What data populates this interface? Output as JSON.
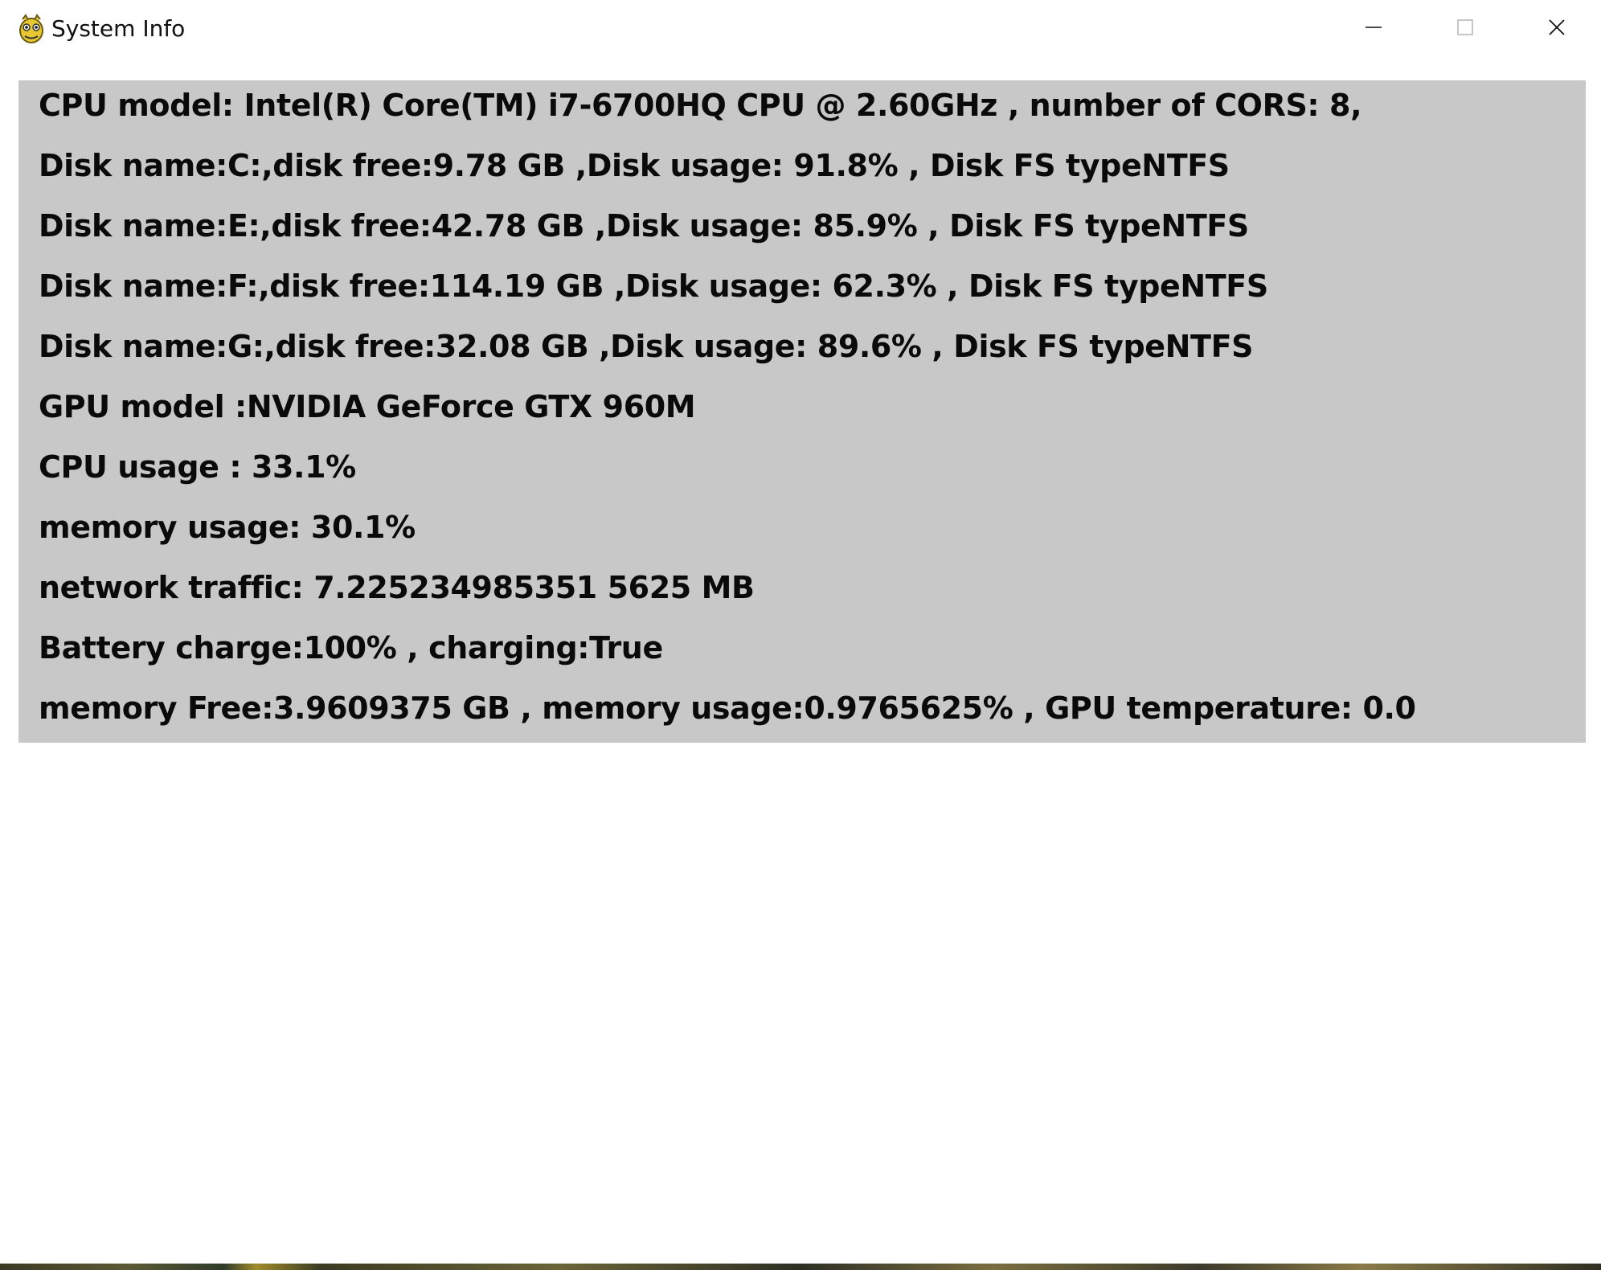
{
  "window": {
    "title": "System Info",
    "app_icon": "pygame-snake-icon",
    "controls": {
      "minimize_icon": "minimize-icon",
      "maximize_icon": "maximize-icon",
      "close_icon": "close-icon"
    }
  },
  "info": {
    "lines": [
      "CPU model: Intel(R) Core(TM) i7-6700HQ CPU @ 2.60GHz , number of CORS: 8,",
      "Disk name:C:,disk free:9.78  GB ,Disk usage: 91.8% , Disk FS typeNTFS",
      "Disk name:E:,disk free:42.78  GB ,Disk usage: 85.9% , Disk FS typeNTFS",
      "Disk name:F:,disk free:114.19  GB ,Disk usage: 62.3% , Disk FS typeNTFS",
      "Disk name:G:,disk free:32.08  GB ,Disk usage: 89.6% , Disk FS typeNTFS",
      "GPU model :NVIDIA GeForce GTX 960M",
      "CPU usage : 33.1%",
      "memory usage: 30.1%",
      "network traffic: 7.225234985351 5625 MB",
      "Battery charge:100% , charging:True",
      "memory Free:3.9609375 GB , memory usage:0.9765625% , GPU temperature: 0.0"
    ]
  },
  "colors": {
    "panel_background": "#c8c8c8",
    "window_background": "#ffffff",
    "text": "#0a0a0a"
  }
}
